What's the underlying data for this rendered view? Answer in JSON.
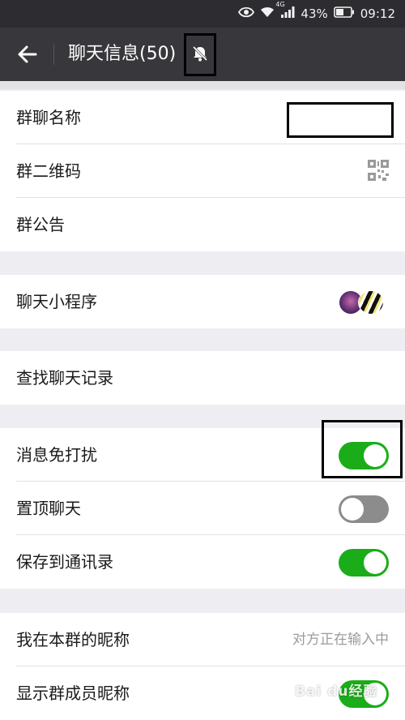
{
  "status_bar": {
    "network": "4G",
    "battery": "43%",
    "time": "09:12"
  },
  "header": {
    "title": "聊天信息(50)",
    "back_icon": "back-arrow-icon",
    "mute_icon": "bell-off-icon"
  },
  "sections": {
    "group_name_label": "群聊名称",
    "group_qr_label": "群二维码",
    "group_notice_label": "群公告",
    "mini_programs_label": "聊天小程序",
    "search_history_label": "查找聊天记录",
    "mute_label": "消息免打扰",
    "mute_on": true,
    "pin_label": "置顶聊天",
    "pin_on": false,
    "save_contacts_label": "保存到通讯录",
    "save_contacts_on": true,
    "my_nickname_label": "我在本群的昵称",
    "my_nickname_value": "对方正在输入中",
    "show_nicknames_label": "显示群成员昵称",
    "show_nicknames_on": true
  },
  "colors": {
    "toggle_on": "#1aad19",
    "toggle_off": "#8c8c8c",
    "title_bar": "#38383c"
  },
  "watermark": "Bai du经验"
}
